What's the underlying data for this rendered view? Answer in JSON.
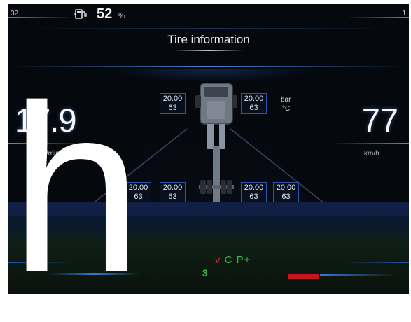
{
  "header": {
    "corner_left": "32",
    "corner_right": "1",
    "fuel_icon": "fuel-pump-icon",
    "fuel_level": "52",
    "fuel_unit": "%"
  },
  "screen": {
    "title": "Tire information"
  },
  "gauges": {
    "rpm_value": "17.9",
    "rpm_unit": "0r/min",
    "speed_value": "77",
    "speed_unit": "km/h"
  },
  "units": {
    "pressure": "bar",
    "temperature": "°C"
  },
  "tires": {
    "front_left": {
      "pressure": "20.00",
      "temp": "63"
    },
    "front_right": {
      "pressure": "20.00",
      "temp": "63"
    },
    "rear_left_outer": {
      "pressure": "20.00",
      "temp": "63"
    },
    "rear_left_inner": {
      "pressure": "20.00",
      "temp": "63"
    },
    "rear_right_inner": {
      "pressure": "20.00",
      "temp": "63"
    },
    "rear_right_outer": {
      "pressure": "20.00",
      "temp": "63"
    }
  },
  "status": {
    "warn_mark": "v",
    "drive_mode": "C P+",
    "gear": "3"
  },
  "overlay": {
    "letter": "h"
  },
  "colors": {
    "background": "#05080d",
    "accent_blue": "#4a8ef0",
    "tire_box_border": "#2d56a8",
    "drive_green": "#2fbf4a",
    "warning_red": "#d22a2a"
  }
}
